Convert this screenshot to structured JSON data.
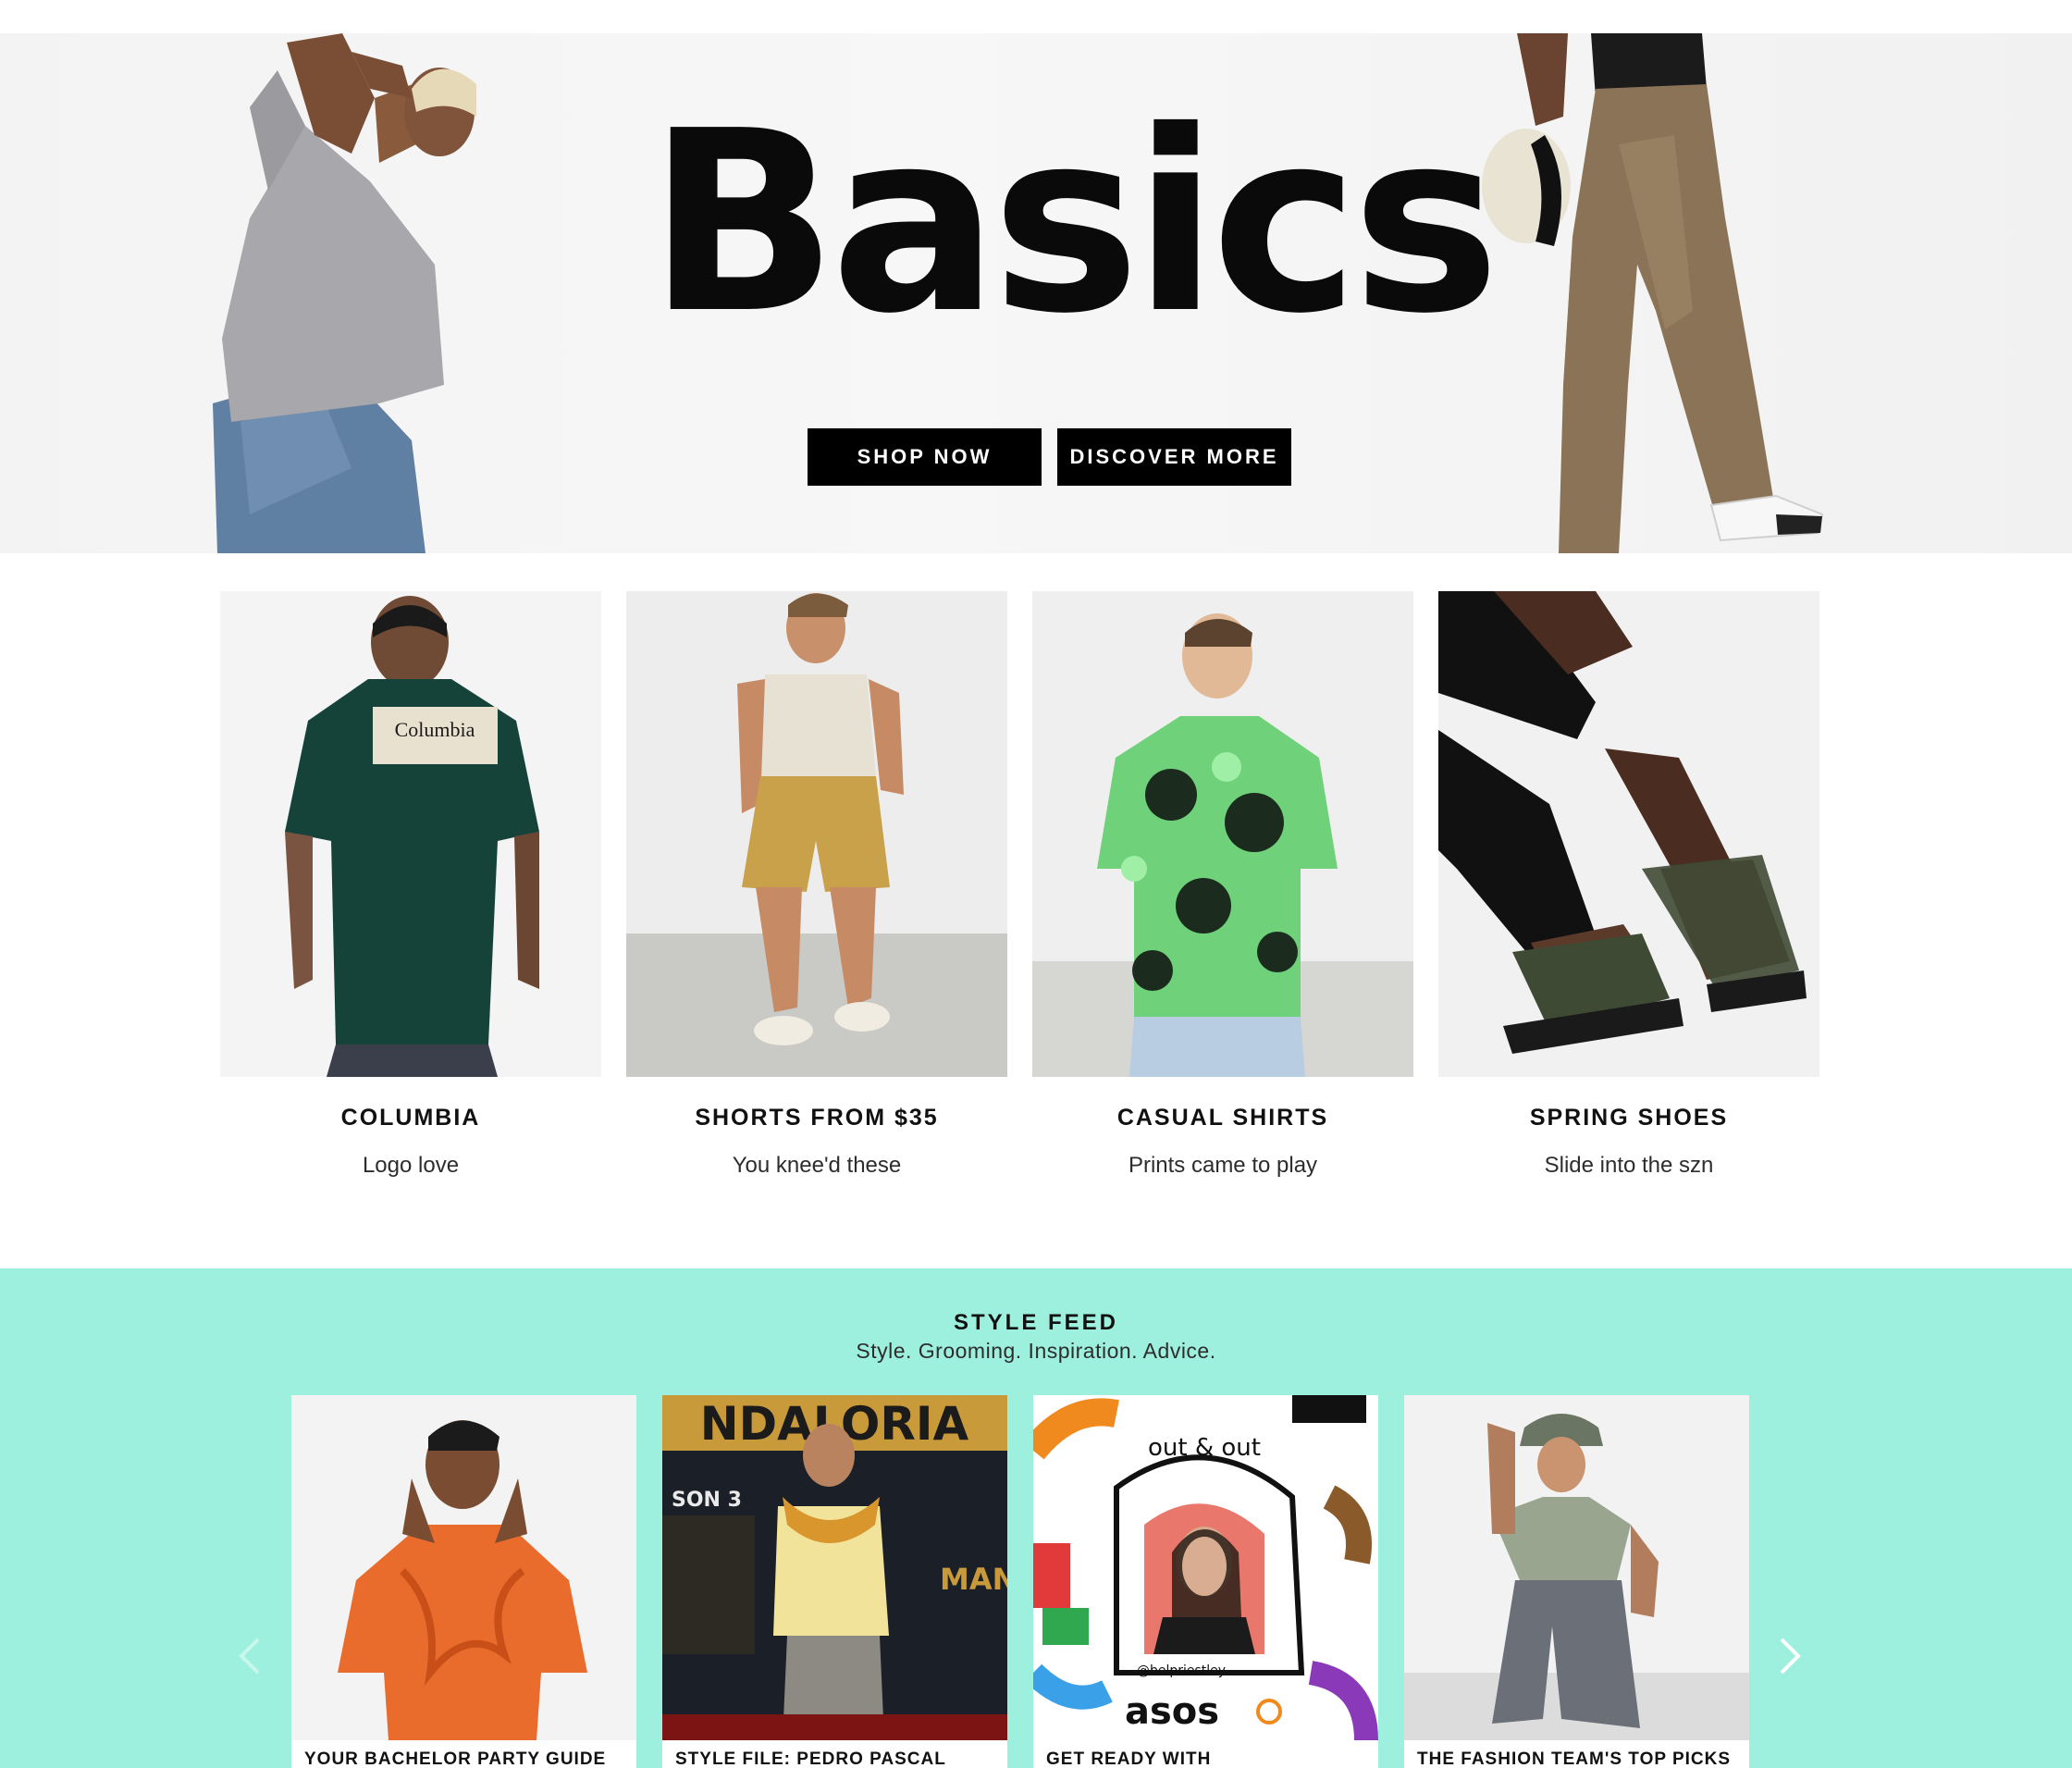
{
  "hero": {
    "title": "Basics",
    "shop_now_label": "SHOP NOW",
    "discover_more_label": "DISCOVER MORE"
  },
  "cards": [
    {
      "title": "COLUMBIA",
      "subtitle": "Logo love"
    },
    {
      "title": "SHORTS FROM $35",
      "subtitle": "You knee'd these"
    },
    {
      "title": "CASUAL SHIRTS",
      "subtitle": "Prints came to play"
    },
    {
      "title": "SPRING SHOES",
      "subtitle": "Slide into the szn"
    }
  ],
  "style_feed": {
    "title": "STYLE FEED",
    "subtitle": "Style. Grooming. Inspiration. Advice.",
    "cards": [
      {
        "caption": "YOUR BACHELOR PARTY GUIDE"
      },
      {
        "caption": "STYLE FILE: PEDRO PASCAL"
      },
      {
        "caption": "GET READY WITH"
      },
      {
        "caption": "THE FASHION TEAM'S TOP PICKS"
      }
    ],
    "card_art_text": {
      "columbia_logo": "Columbia",
      "banner_top": "NDALORIA",
      "banner_mid": "SON 3",
      "banner_low": "MANDA",
      "badge": "out & out",
      "handle": "@belpriestley",
      "brand": "asos"
    }
  },
  "colors": {
    "feed_background": "#9ef0de",
    "button_background": "#000000"
  }
}
